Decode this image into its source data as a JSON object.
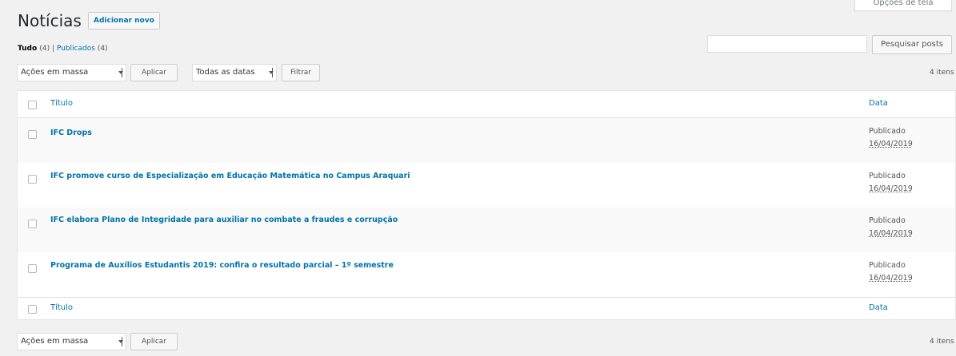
{
  "screen_options": {
    "label": "Opções de tela"
  },
  "header": {
    "title": "Notícias",
    "add_new": "Adicionar novo"
  },
  "views": {
    "all_label": "Tudo",
    "all_count": "(4)",
    "separator": "|",
    "published_label": "Publicados",
    "published_count": "(4)"
  },
  "search": {
    "placeholder": "",
    "button": "Pesquisar posts"
  },
  "top_nav": {
    "bulk_select": "Ações em massa",
    "apply": "Aplicar",
    "date_select": "Todas as datas",
    "filter": "Filtrar",
    "count": "4 itens"
  },
  "table": {
    "col_title": "Título",
    "col_date": "Data",
    "rows": [
      {
        "title": "IFC Drops",
        "status": "Publicado",
        "date": "16/04/2019"
      },
      {
        "title": "IFC promove curso de Especialização em Educação Matemática no Campus Araquari",
        "status": "Publicado",
        "date": "16/04/2019"
      },
      {
        "title": "IFC elabora Plano de Integridade para auxiliar no combate a fraudes e corrupção",
        "status": "Publicado",
        "date": "16/04/2019"
      },
      {
        "title": "Programa de Auxílios Estudantis 2019: confira o resultado parcial – 1º semestre",
        "status": "Publicado",
        "date": "16/04/2019"
      }
    ]
  },
  "bottom_nav": {
    "bulk_select": "Ações em massa",
    "apply": "Aplicar",
    "count": "4 itens"
  },
  "colors": {
    "link": "#0073aa",
    "background": "#f1f1f1"
  }
}
